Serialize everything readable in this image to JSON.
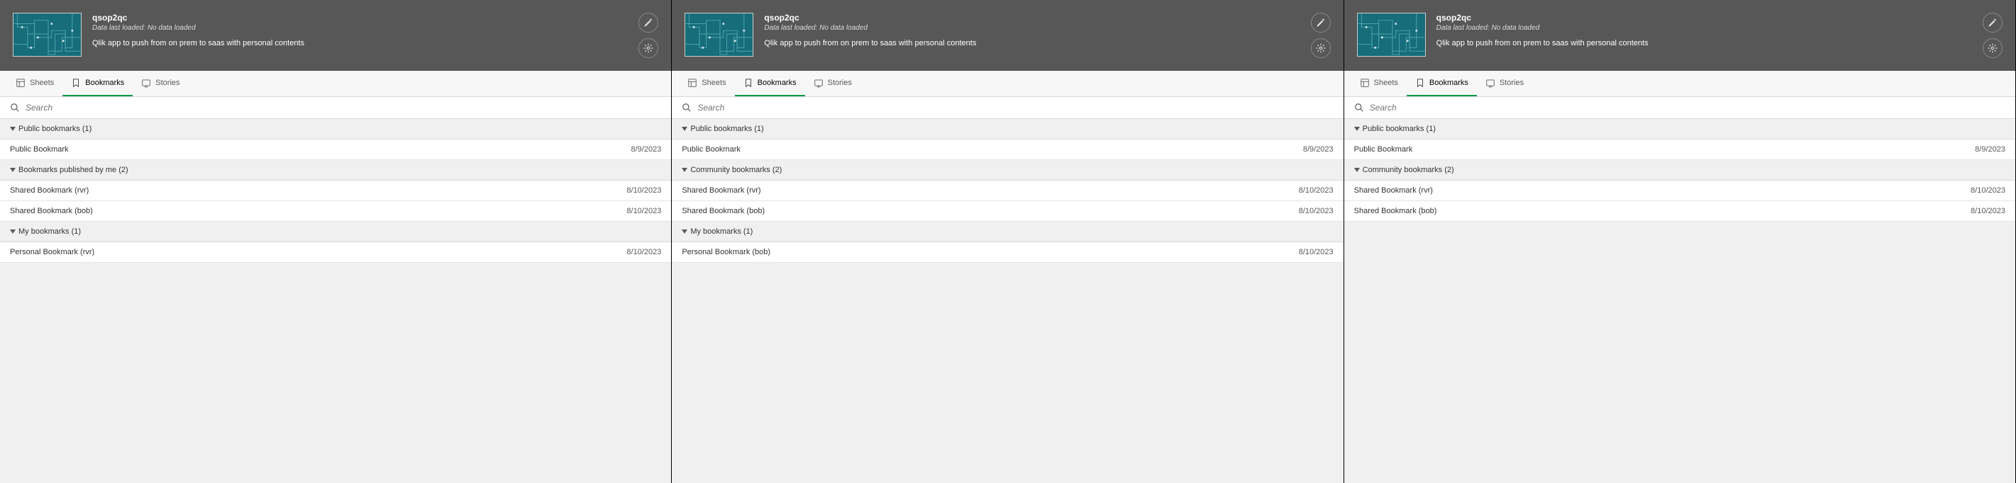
{
  "app": {
    "title": "qsop2qc",
    "subtitle": "Data last loaded: No data loaded",
    "desc": "Qlik app to push from on prem to saas with personal contents"
  },
  "tabs": {
    "sheets": "Sheets",
    "bookmarks": "Bookmarks",
    "stories": "Stories"
  },
  "search_placeholder": "Search",
  "panels": [
    {
      "sections": [
        {
          "title": "Public bookmarks (1)",
          "rows": [
            {
              "name": "Public Bookmark",
              "date": "8/9/2023"
            }
          ]
        },
        {
          "title": "Bookmarks published by me (2)",
          "rows": [
            {
              "name": "Shared Bookmark (rvr)",
              "date": "8/10/2023"
            },
            {
              "name": "Shared Bookmark (bob)",
              "date": "8/10/2023"
            }
          ]
        },
        {
          "title": "My bookmarks (1)",
          "rows": [
            {
              "name": "Personal Bookmark (rvr)",
              "date": "8/10/2023"
            }
          ]
        }
      ]
    },
    {
      "sections": [
        {
          "title": "Public bookmarks (1)",
          "rows": [
            {
              "name": "Public Bookmark",
              "date": "8/9/2023"
            }
          ]
        },
        {
          "title": "Community bookmarks (2)",
          "rows": [
            {
              "name": "Shared Bookmark (rvr)",
              "date": "8/10/2023"
            },
            {
              "name": "Shared Bookmark (bob)",
              "date": "8/10/2023"
            }
          ]
        },
        {
          "title": "My bookmarks (1)",
          "rows": [
            {
              "name": "Personal Bookmark (bob)",
              "date": "8/10/2023"
            }
          ]
        }
      ]
    },
    {
      "sections": [
        {
          "title": "Public bookmarks (1)",
          "rows": [
            {
              "name": "Public Bookmark",
              "date": "8/9/2023"
            }
          ]
        },
        {
          "title": "Community bookmarks (2)",
          "rows": [
            {
              "name": "Shared Bookmark (rvr)",
              "date": "8/10/2023"
            },
            {
              "name": "Shared Bookmark (bob)",
              "date": "8/10/2023"
            }
          ]
        }
      ]
    }
  ]
}
